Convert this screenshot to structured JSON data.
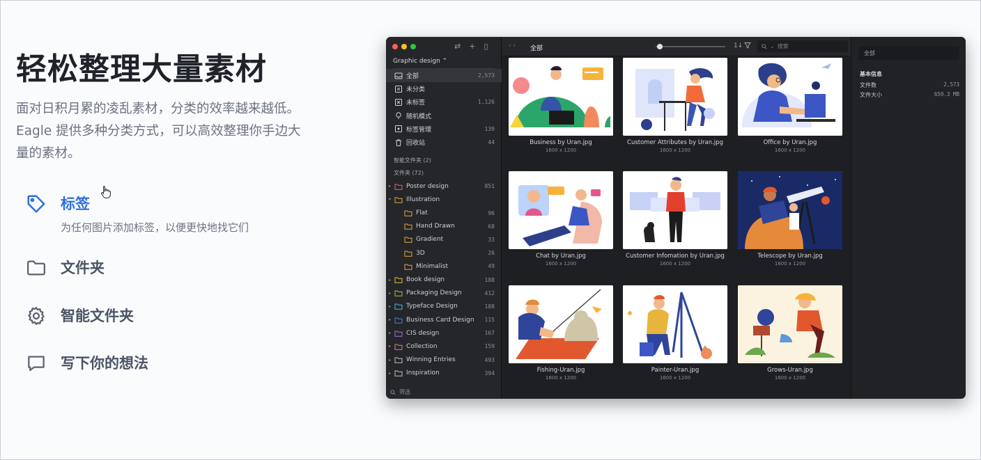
{
  "hero": {
    "title": "轻松整理大量素材",
    "description": "面对日积月累的凌乱素材，分类的效率越来越低。Eagle 提供多种分类方式，可以高效整理你手边大量的素材。"
  },
  "features": [
    {
      "label": "标签",
      "sub": "为任何图片添加标签，以便更快地找它们",
      "icon": "tag-icon",
      "active": true
    },
    {
      "label": "文件夹",
      "icon": "folder-icon"
    },
    {
      "label": "智能文件夹",
      "icon": "gear-icon"
    },
    {
      "label": "写下你的想法",
      "icon": "comment-icon"
    }
  ],
  "colors": {
    "accent": "#2f6fde",
    "feature_text": "#4b5563",
    "window_bg": "#1e1f22"
  },
  "app": {
    "library": "Graphic design ⌃",
    "sidebar_top": [
      {
        "label": "全部",
        "count": "2,573",
        "icon": "inbox-icon"
      },
      {
        "label": "未分类",
        "count": "",
        "icon": "uncategorized-icon"
      },
      {
        "label": "未标签",
        "count": "1,126",
        "icon": "untagged-icon"
      },
      {
        "label": "随机模式",
        "count": "",
        "icon": "random-icon"
      },
      {
        "label": "标签管理",
        "count": "139",
        "icon": "tag-manage-icon"
      },
      {
        "label": "回收站",
        "count": "44",
        "icon": "trash-icon"
      }
    ],
    "smart_folders": "智能文件夹 (2)",
    "folders_header": "文件夹 (72)",
    "folders": [
      {
        "label": "Poster design",
        "count": "851",
        "color": "#e0606a"
      },
      {
        "label": "Illustration",
        "count": "",
        "color": "#e0a83a",
        "open": true
      },
      {
        "label": "Flat",
        "count": "96",
        "color": "#e0a83a",
        "child": true
      },
      {
        "label": "Hand Drawn",
        "count": "68",
        "color": "#e0a83a",
        "child": true
      },
      {
        "label": "Gradient",
        "count": "33",
        "color": "#e0a83a",
        "child": true
      },
      {
        "label": "3D",
        "count": "26",
        "color": "#e0a83a",
        "child": true
      },
      {
        "label": "Minimalist",
        "count": "49",
        "color": "#e0a83a",
        "child": true
      },
      {
        "label": "Book design",
        "count": "188",
        "color": "#e0c43a"
      },
      {
        "label": "Packaging Design",
        "count": "412",
        "color": "#9bc34a"
      },
      {
        "label": "Typeface Design",
        "count": "108",
        "color": "#4ab8d8"
      },
      {
        "label": "Business Card Design",
        "count": "115",
        "color": "#4a82d8"
      },
      {
        "label": "CIS design",
        "count": "167",
        "color": "#9a7ad8"
      },
      {
        "label": "Collection",
        "count": "159",
        "color": "#d87aa8"
      },
      {
        "label": "Winning Entries",
        "count": "493",
        "color": "#bfbfbf"
      },
      {
        "label": "Inspiration",
        "count": "394",
        "color": "#bfbfbf"
      }
    ],
    "filter_label": "筛选",
    "toolbar": {
      "title": "全部",
      "search_placeholder": "搜索",
      "sort": "1↓"
    },
    "cards": [
      {
        "name": "Business by Uran.jpg",
        "dim": "1600 x 1200"
      },
      {
        "name": "Customer Attributes by Uran.jpg",
        "dim": "1600 x 1200"
      },
      {
        "name": "Office by Uran.jpg",
        "dim": "1600 x 1200"
      },
      {
        "name": "Chat by Uran.jpg",
        "dim": "1600 x 1200"
      },
      {
        "name": "Customer Infomation by Uran.jpg",
        "dim": "1600 x 1200"
      },
      {
        "name": "Telescope by Uran.jpg",
        "dim": "1600 x 1200"
      },
      {
        "name": "Fishing-Uran.jpg",
        "dim": "1600 x 1200"
      },
      {
        "name": "Painter-Uran.jpg",
        "dim": "1600 x 1200"
      },
      {
        "name": "Grows-Uran.jpg",
        "dim": "1600 x 1200"
      }
    ],
    "inspector": {
      "field": "全部",
      "heading": "基本信息",
      "rows": [
        {
          "label": "文件数",
          "value": "2,573"
        },
        {
          "label": "文件大小",
          "value": "659.3 MB"
        }
      ]
    }
  }
}
